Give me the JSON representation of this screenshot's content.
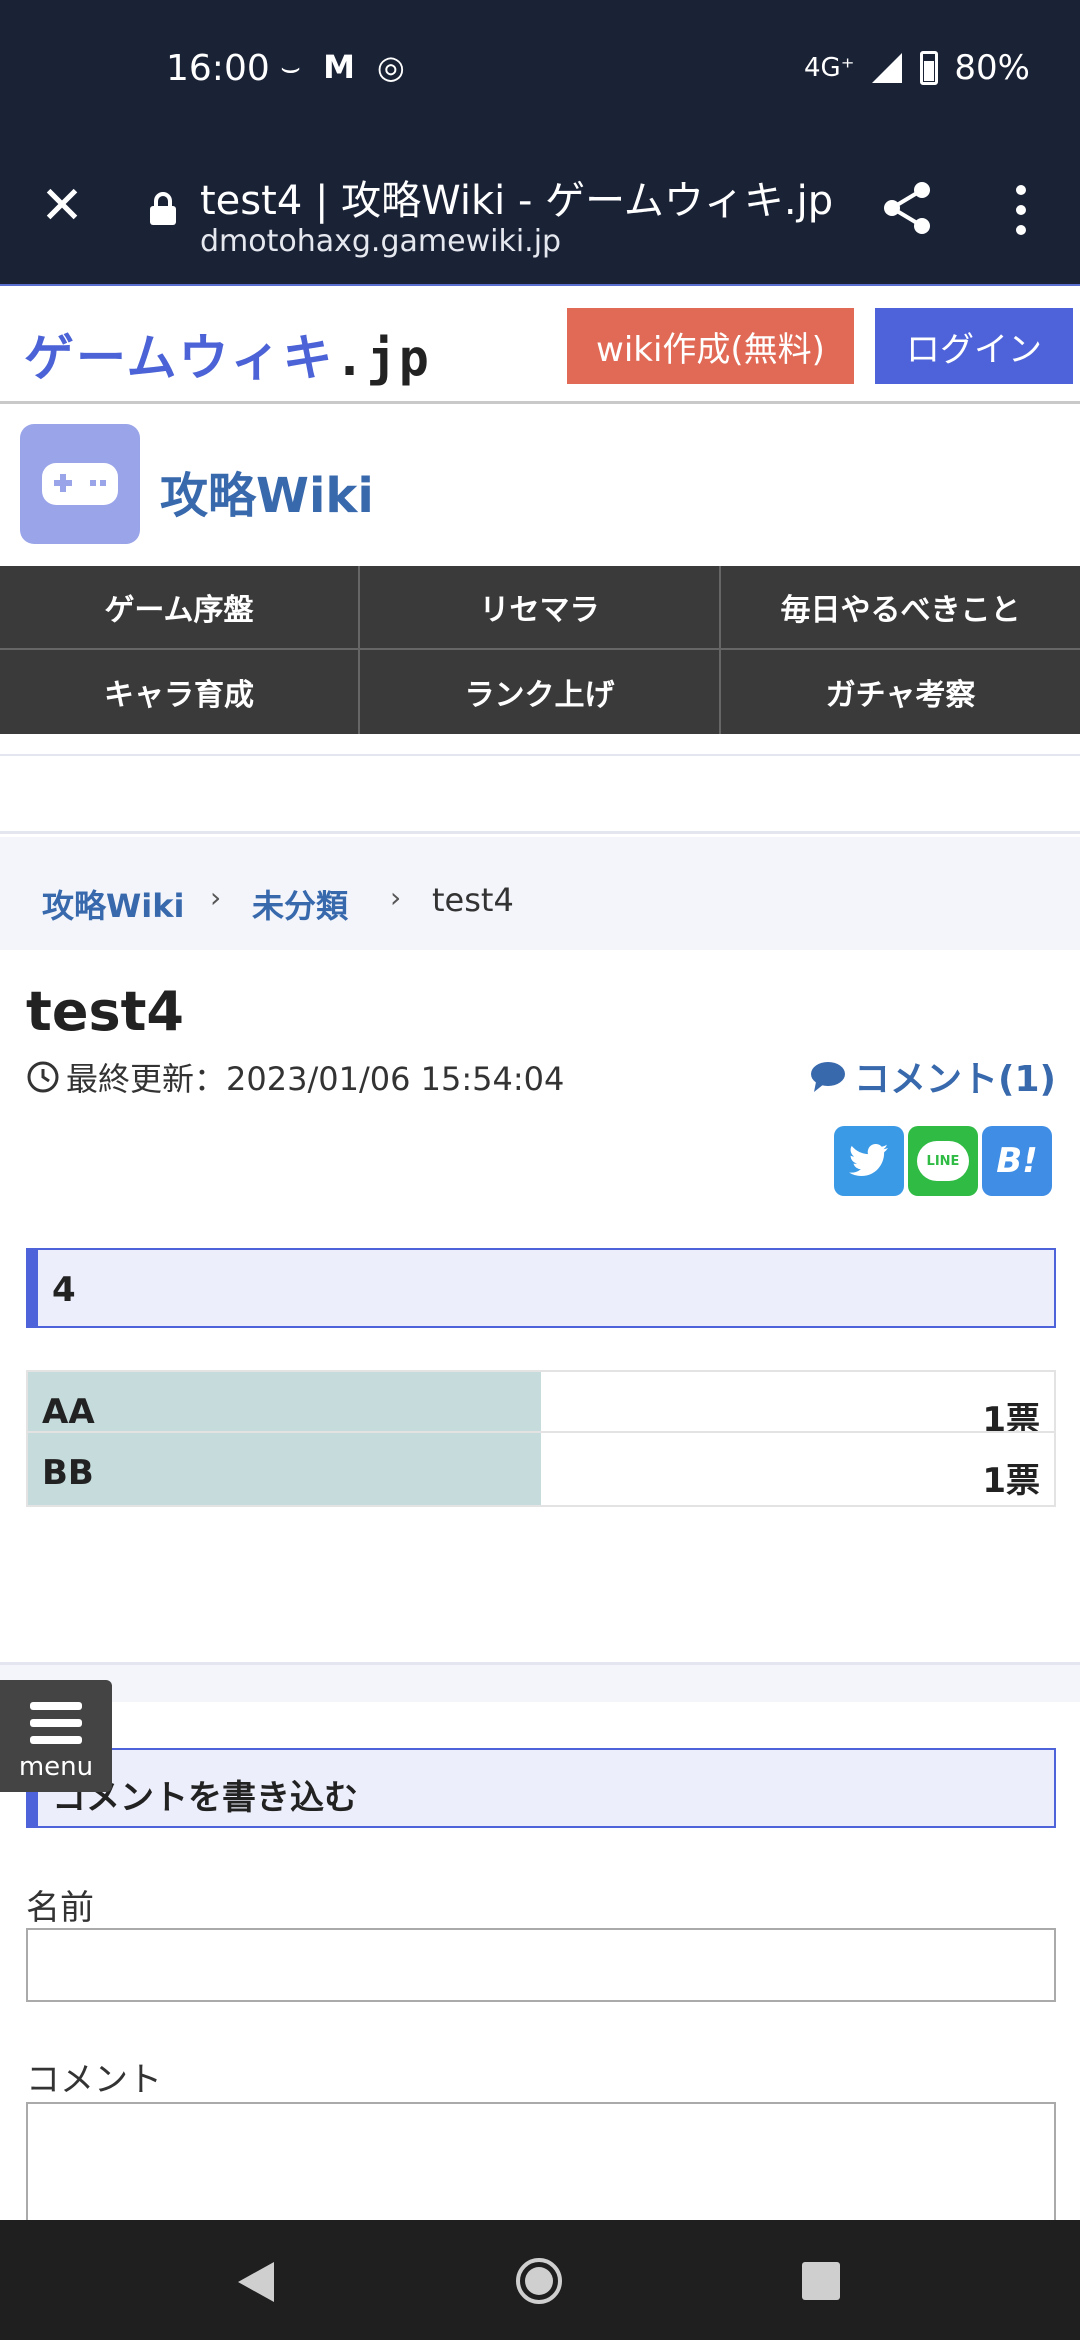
{
  "status_bar": {
    "time": "16:00",
    "network": "4G⁺",
    "battery": "80%"
  },
  "browser": {
    "title": "test4 | 攻略Wiki - ゲームウィキ.jp",
    "url": "dmotohaxg.gamewiki.jp"
  },
  "site": {
    "logo_main": "ゲームウィキ",
    "logo_suffix": ".jp",
    "create_button": "wiki作成(無料)",
    "login_button": "ログイン",
    "wiki_name": "攻略Wiki"
  },
  "nav": [
    "ゲーム序盤",
    "リセマラ",
    "毎日やるべきこと",
    "キャラ育成",
    "ランク上げ",
    "ガチャ考察"
  ],
  "breadcrumb": {
    "home": "攻略Wiki",
    "category": "未分類",
    "current": "test4",
    "separator": "›"
  },
  "article": {
    "title": "test4",
    "updated": "最終更新：2023/01/06 15:54:04",
    "comment_link": "コメント(1)",
    "share_hatena": "B!",
    "share_line": "LINE"
  },
  "poll": {
    "title": "4",
    "options": [
      {
        "label": "AA",
        "votes": "1票",
        "share": 0.5
      },
      {
        "label": "BB",
        "votes": "1票",
        "share": 0.5
      }
    ]
  },
  "comment_form": {
    "heading": "コメントを書き込む",
    "name_label": "名前",
    "name_value": "",
    "comment_label": "コメント",
    "comment_value": ""
  },
  "menu_button": {
    "label": "menu"
  },
  "colors": {
    "header_bg": "#1a2236",
    "create_btn": "#e06a55",
    "login_btn": "#4e63d9",
    "link": "#3869ad",
    "poll_fill": "#c5dbdc"
  }
}
